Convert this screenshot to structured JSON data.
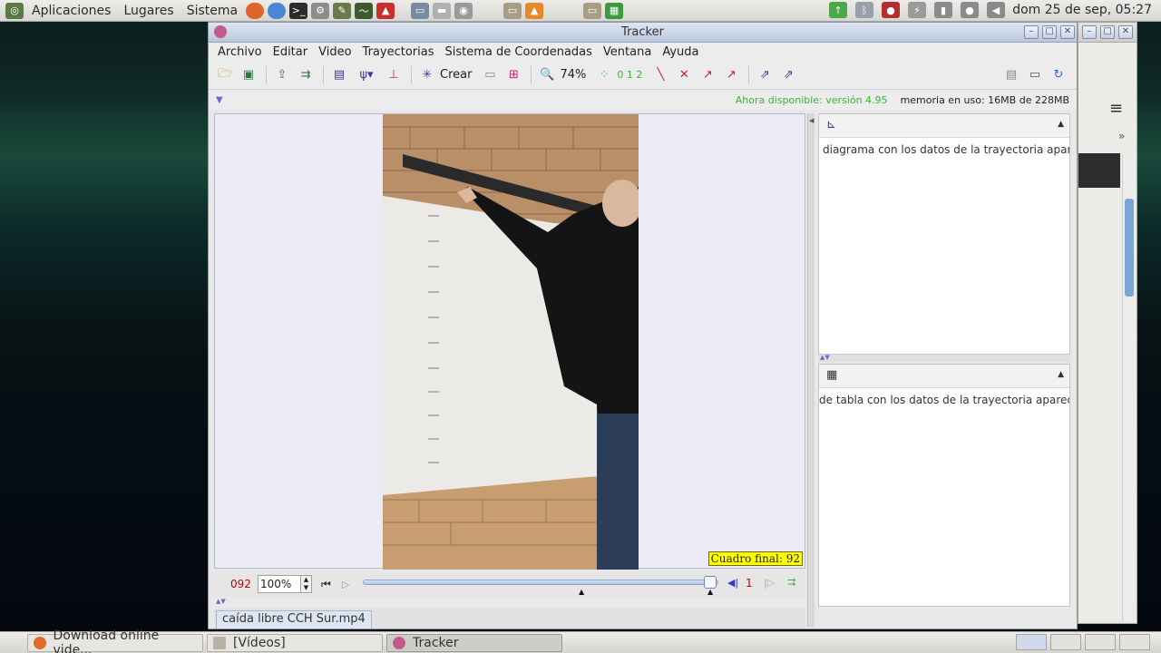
{
  "top_panel": {
    "menus": [
      "Aplicaciones",
      "Lugares",
      "Sistema"
    ],
    "clock": "dom 25 de sep, 05:27"
  },
  "taskbar": {
    "tasks": [
      {
        "label": "Download online vide...",
        "color": "#e06a2c"
      },
      {
        "label": "[Vídeos]",
        "color": "#b9b2a2"
      },
      {
        "label": "Tracker",
        "color": "#c25a8a"
      }
    ]
  },
  "window": {
    "title": "Tracker",
    "menus": [
      "Archivo",
      "Editar",
      "Video",
      "Trayectorias",
      "Sistema de Coordenadas",
      "Ventana",
      "Ayuda"
    ],
    "toolbar": {
      "create_label": "Crear",
      "zoom_label": "74%",
      "fraction_label": "0 1 2"
    },
    "status": {
      "update_notice": "Ahora disponible: versión 4.95",
      "memory": "memoria en uso: 16MB de 228MB"
    },
    "video": {
      "overlay_label": "Cuadro final: 92"
    },
    "player": {
      "frame_number": "092",
      "zoom_value": "100%",
      "step_value": "1",
      "slider_position": 0.98
    },
    "file_tab": "caída libre CCH Sur.mp4",
    "plot_pane": {
      "message": "diagrama con los datos de la trayectoria apare"
    },
    "table_pane": {
      "message": "de tabla con los datos de la trayectoria aparec"
    }
  },
  "colors": {
    "accent_green": "#38b638",
    "frame_red": "#c00000",
    "overlay_yellow": "#ffff00"
  }
}
